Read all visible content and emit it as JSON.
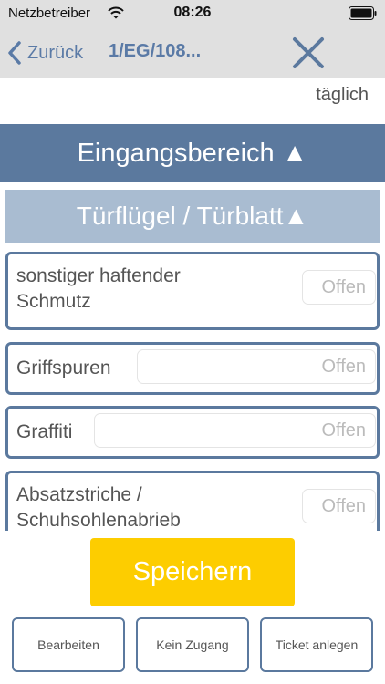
{
  "status_bar": {
    "carrier": "Netzbetreiber",
    "time": "08:26"
  },
  "nav": {
    "back_label": "Zurück",
    "title": "1/EG/108..."
  },
  "frequency": "täglich",
  "section": {
    "title": "Eingangsbereich ▲"
  },
  "subsection": {
    "title": "Türflügel / Türblatt▲"
  },
  "items": [
    {
      "label_line1": "sonstiger haftender",
      "label_line2": "Schmutz",
      "status": "Offen"
    },
    {
      "label_line1": "Griffspuren",
      "status": "Offen"
    },
    {
      "label_line1": "Graffiti",
      "status": "Offen"
    },
    {
      "label_line1": "Absatzstriche /",
      "label_line2": "Schuhsohlenabrieb",
      "status": "Offen"
    }
  ],
  "save_label": "Speichern",
  "footer": {
    "edit_label": "Bearbeiten",
    "no_access_label": "Kein Zugang",
    "ticket_label": "Ticket anlegen"
  },
  "colors": {
    "accent_blue": "#5b799e",
    "light_blue": "#a9bcd1",
    "save_yellow": "#fdcd00",
    "bar_gray": "#e0e0e0"
  },
  "icons": {
    "wifi": "wifi-icon",
    "battery": "battery-icon",
    "back": "chevron-left-icon",
    "close": "close-icon"
  }
}
